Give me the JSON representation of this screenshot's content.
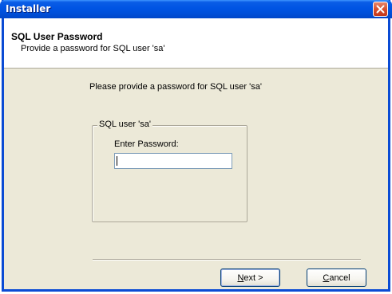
{
  "window": {
    "title": "Installer"
  },
  "header": {
    "title": "SQL User Password",
    "subtitle": "Provide a password for SQL user 'sa'"
  },
  "main": {
    "prompt": "Please provide a password for SQL user 'sa'",
    "group": {
      "legend": "SQL user 'sa'",
      "password_label": "Enter Password:",
      "password_value": ""
    }
  },
  "buttons": {
    "next": {
      "mnemonic": "N",
      "rest": "ext >"
    },
    "cancel": {
      "mnemonic": "C",
      "rest": "ancel"
    }
  },
  "icons": {
    "close": "close-icon"
  },
  "colors": {
    "titlebar": "#0054e3",
    "dialog_background": "#ece9d8",
    "close_button": "#d8502e"
  }
}
